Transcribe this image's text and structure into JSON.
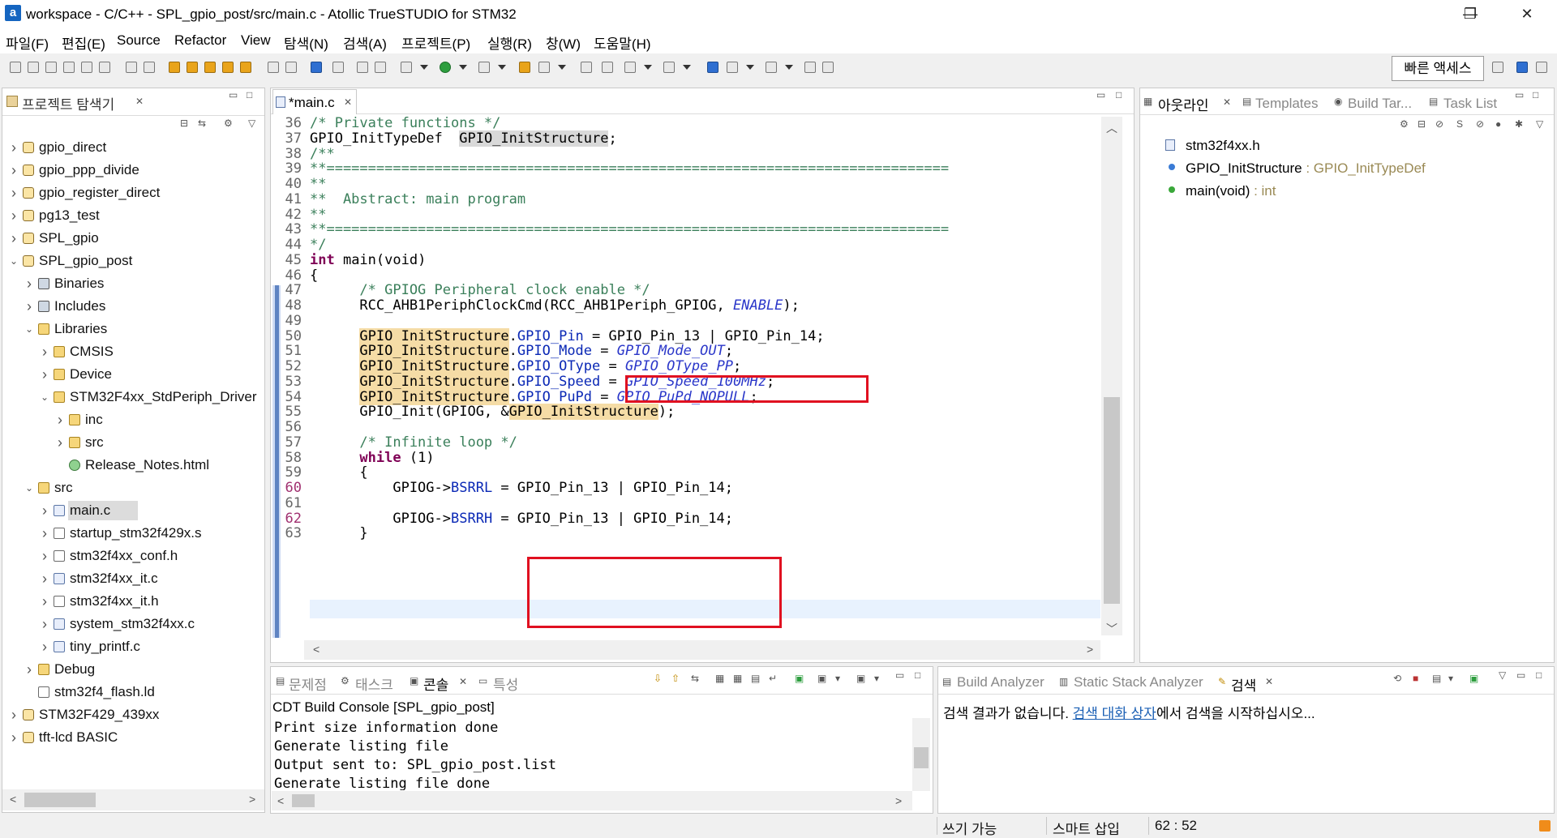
{
  "window": {
    "title": "workspace - C/C++ - SPL_gpio_post/src/main.c - Atollic TrueSTUDIO for STM32",
    "app_icon": "a",
    "minimize": "—",
    "maximize": "❐",
    "close": "✕"
  },
  "menu": [
    "파일(F)",
    "편집(E)",
    "Source",
    "Refactor",
    "View",
    "탐색(N)",
    "검색(A)",
    "프로젝트(P)",
    "실행(R)",
    "창(W)",
    "도움말(H)"
  ],
  "quick_access": "빠른 액세스",
  "project_explorer": {
    "tab_label": "프로젝트 탐색기",
    "items": [
      {
        "label": "gpio_direct",
        "depth": 0,
        "expanded": false,
        "icon": "project"
      },
      {
        "label": "gpio_ppp_divide",
        "depth": 0,
        "expanded": false,
        "icon": "project"
      },
      {
        "label": "gpio_register_direct",
        "depth": 0,
        "expanded": false,
        "icon": "project"
      },
      {
        "label": "pg13_test",
        "depth": 0,
        "expanded": false,
        "icon": "project"
      },
      {
        "label": "SPL_gpio",
        "depth": 0,
        "expanded": false,
        "icon": "project"
      },
      {
        "label": "SPL_gpio_post",
        "depth": 0,
        "expanded": true,
        "icon": "project"
      },
      {
        "label": "Binaries",
        "depth": 1,
        "expanded": false,
        "icon": "binaries"
      },
      {
        "label": "Includes",
        "depth": 1,
        "expanded": false,
        "icon": "includes"
      },
      {
        "label": "Libraries",
        "depth": 1,
        "expanded": true,
        "icon": "folder"
      },
      {
        "label": "CMSIS",
        "depth": 2,
        "expanded": false,
        "icon": "folder"
      },
      {
        "label": "Device",
        "depth": 2,
        "expanded": false,
        "icon": "folder"
      },
      {
        "label": "STM32F4xx_StdPeriph_Driver",
        "depth": 2,
        "expanded": true,
        "icon": "folder"
      },
      {
        "label": "inc",
        "depth": 3,
        "expanded": false,
        "icon": "folder"
      },
      {
        "label": "src",
        "depth": 3,
        "expanded": false,
        "icon": "folder"
      },
      {
        "label": "Release_Notes.html",
        "depth": 3,
        "expanded": null,
        "icon": "html"
      },
      {
        "label": "src",
        "depth": 1,
        "expanded": true,
        "icon": "srcfolder"
      },
      {
        "label": "main.c",
        "depth": 2,
        "expanded": false,
        "icon": "cfile",
        "selected": true
      },
      {
        "label": "startup_stm32f429x.s",
        "depth": 2,
        "expanded": false,
        "icon": "file"
      },
      {
        "label": "stm32f4xx_conf.h",
        "depth": 2,
        "expanded": false,
        "icon": "file"
      },
      {
        "label": "stm32f4xx_it.c",
        "depth": 2,
        "expanded": false,
        "icon": "cfile"
      },
      {
        "label": "stm32f4xx_it.h",
        "depth": 2,
        "expanded": false,
        "icon": "file"
      },
      {
        "label": "system_stm32f4xx.c",
        "depth": 2,
        "expanded": false,
        "icon": "cfile"
      },
      {
        "label": "tiny_printf.c",
        "depth": 2,
        "expanded": false,
        "icon": "cfile"
      },
      {
        "label": "Debug",
        "depth": 1,
        "expanded": false,
        "icon": "folder"
      },
      {
        "label": "stm32f4_flash.ld",
        "depth": 1,
        "expanded": null,
        "icon": "file"
      },
      {
        "label": "STM32F429_439xx",
        "depth": 0,
        "expanded": false,
        "icon": "project"
      },
      {
        "label": "tft-lcd BASIC",
        "depth": 0,
        "expanded": false,
        "icon": "project"
      }
    ]
  },
  "editor": {
    "tab_label": "*main.c",
    "lines": [
      {
        "n": "36",
        "text": "/* Private functions */"
      },
      {
        "n": "37",
        "text": "GPIO_InitTypeDef  GPIO_InitStructure;"
      },
      {
        "n": "38",
        "text": "/**"
      },
      {
        "n": "39",
        "text": "**==========================================================================="
      },
      {
        "n": "40",
        "text": "**"
      },
      {
        "n": "41",
        "text": "**  Abstract: main program"
      },
      {
        "n": "42",
        "text": "**"
      },
      {
        "n": "43",
        "text": "**==========================================================================="
      },
      {
        "n": "44",
        "text": "*/"
      },
      {
        "n": "45",
        "text": "int main(void)"
      },
      {
        "n": "46",
        "text": "{"
      },
      {
        "n": "47",
        "text": "      /* GPIOG Peripheral clock enable */"
      },
      {
        "n": "48",
        "text": "      RCC_AHB1PeriphClockCmd(RCC_AHB1Periph_GPIOG, ENABLE);"
      },
      {
        "n": "49",
        "text": ""
      },
      {
        "n": "50",
        "text": "      GPIO_InitStructure.GPIO_Pin = GPIO_Pin_13 | GPIO_Pin_14;"
      },
      {
        "n": "51",
        "text": "      GPIO_InitStructure.GPIO_Mode = GPIO_Mode_OUT;"
      },
      {
        "n": "52",
        "text": "      GPIO_InitStructure.GPIO_OType = GPIO_OType_PP;"
      },
      {
        "n": "53",
        "text": "      GPIO_InitStructure.GPIO_Speed = GPIO_Speed_100MHz;"
      },
      {
        "n": "54",
        "text": "      GPIO_InitStructure.GPIO_PuPd = GPIO_PuPd_NOPULL;"
      },
      {
        "n": "55",
        "text": "      GPIO_Init(GPIOG, &GPIO_InitStructure);"
      },
      {
        "n": "56",
        "text": ""
      },
      {
        "n": "57",
        "text": "      /* Infinite loop */"
      },
      {
        "n": "58",
        "text": "      while (1)"
      },
      {
        "n": "59",
        "text": "      {"
      },
      {
        "n": "60",
        "text": "          GPIOG->BSRRL = GPIO_Pin_13 | GPIO_Pin_14;"
      },
      {
        "n": "61",
        "text": ""
      },
      {
        "n": "62",
        "text": "          GPIOG->BSRRH = GPIO_Pin_13 | GPIO_Pin_14;"
      },
      {
        "n": "63",
        "text": "      }"
      }
    ]
  },
  "outline": {
    "tabs": [
      "아웃라인",
      "Templates",
      "Build Tar...",
      "Task List"
    ],
    "items": [
      {
        "name": "stm32f4xx.h",
        "type": ""
      },
      {
        "name": "GPIO_InitStructure",
        "type": " : GPIO_InitTypeDef"
      },
      {
        "name": "main(void)",
        "type": " : int"
      }
    ]
  },
  "bottom_left": {
    "tabs": [
      "문제점",
      "태스크",
      "콘솔",
      "특성"
    ],
    "console_title": "CDT Build Console [SPL_gpio_post]",
    "lines": [
      "Print size information done",
      "Generate listing file",
      "Output sent to: SPL_gpio_post.list",
      "Generate listing file done"
    ]
  },
  "bottom_right": {
    "tabs": [
      "Build Analyzer",
      "Static Stack Analyzer",
      "검색"
    ],
    "message_before": "검색 결과가 없습니다. ",
    "message_link": "검색 대화 상자",
    "message_after": "에서 검색을 시작하십시오..."
  },
  "status": {
    "writable": "쓰기 가능",
    "insert_mode": "스마트 삽입",
    "position": "62 : 52"
  },
  "colors": {
    "keyword": "#7f0055",
    "comment": "#3a7f5a",
    "macro": "#2a36c9",
    "highlight": "#f5dca6",
    "annotation_box": "#e01020",
    "link": "#1a5fb4"
  }
}
